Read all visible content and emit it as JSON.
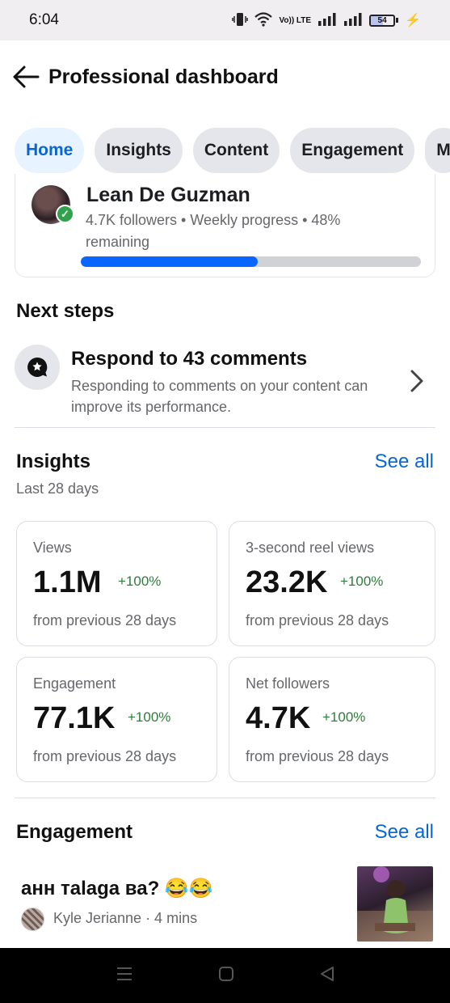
{
  "status_bar": {
    "time": "6:04",
    "battery_level": "54",
    "network_label": "Vo)) LTE"
  },
  "header": {
    "title": "Professional dashboard"
  },
  "tabs": [
    {
      "label": "Home",
      "active": true
    },
    {
      "label": "Insights",
      "active": false
    },
    {
      "label": "Content",
      "active": false
    },
    {
      "label": "Engagement",
      "active": false
    },
    {
      "label": "M",
      "active": false
    }
  ],
  "profile": {
    "name": "Lean De Guzman",
    "meta": "4.7K followers • Weekly progress • 48% remaining",
    "weekly_progress_fraction": 0.52
  },
  "next_steps": {
    "title": "Next steps",
    "item": {
      "title": "Respond to 43 comments",
      "description": "Responding to comments on your content can improve its performance."
    }
  },
  "insights": {
    "title": "Insights",
    "see_all": "See all",
    "period": "Last 28 days",
    "metrics": [
      {
        "label": "Views",
        "value": "1.1M",
        "change": "+100%",
        "sub": "from previous 28 days"
      },
      {
        "label": "3-second reel views",
        "value": "23.2K",
        "change": "+100%",
        "sub": "from previous 28 days"
      },
      {
        "label": "Engagement",
        "value": "77.1K",
        "change": "+100%",
        "sub": "from previous 28 days"
      },
      {
        "label": "Net followers",
        "value": "4.7K",
        "change": "+100%",
        "sub": "from previous 28 days"
      }
    ]
  },
  "engagement": {
    "title": "Engagement",
    "see_all": "See all",
    "item": {
      "comment": "анн тalaga ва? 😂😂",
      "author_time": "Kyle Jerianne · 4 mins"
    }
  },
  "colors": {
    "accent": "#0866ff",
    "link": "#0866d3",
    "positive": "#2d7d3a"
  }
}
